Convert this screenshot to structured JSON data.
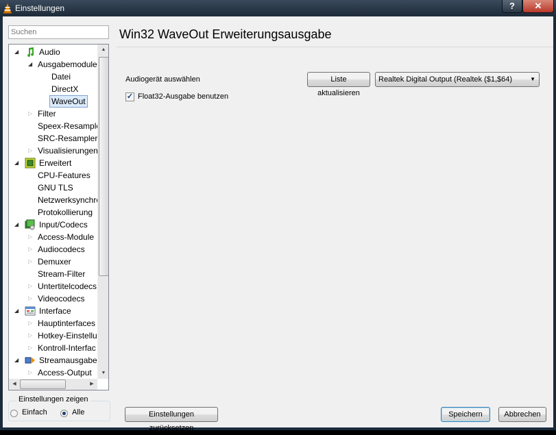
{
  "window": {
    "title": "Einstellungen",
    "help_label": "?",
    "close_label": "✕"
  },
  "search": {
    "placeholder": "Suchen"
  },
  "tree": {
    "items": [
      {
        "label": "Audio",
        "level": 0,
        "expander": "open",
        "icon": "music-note-icon"
      },
      {
        "label": "Ausgabemodule",
        "level": 1,
        "expander": "open"
      },
      {
        "label": "Datei",
        "level": 2,
        "expander": "none"
      },
      {
        "label": "DirectX",
        "level": 2,
        "expander": "none"
      },
      {
        "label": "WaveOut",
        "level": 2,
        "expander": "none",
        "selected": true
      },
      {
        "label": "Filter",
        "level": 1,
        "expander": "closed"
      },
      {
        "label": "Speex-Resampler",
        "level": 1,
        "expander": "none"
      },
      {
        "label": "SRC-Resampler",
        "level": 1,
        "expander": "none"
      },
      {
        "label": "Visualisierungen",
        "level": 1,
        "expander": "closed"
      },
      {
        "label": "Erweitert",
        "level": 0,
        "expander": "open",
        "icon": "chip-icon"
      },
      {
        "label": "CPU-Features",
        "level": 1,
        "expander": "none"
      },
      {
        "label": "GNU TLS",
        "level": 1,
        "expander": "none"
      },
      {
        "label": "Netzwerksynchro",
        "level": 1,
        "expander": "none"
      },
      {
        "label": "Protokollierung",
        "level": 1,
        "expander": "none"
      },
      {
        "label": "Input/Codecs",
        "level": 0,
        "expander": "open",
        "icon": "codec-icon"
      },
      {
        "label": "Access-Module",
        "level": 1,
        "expander": "closed"
      },
      {
        "label": "Audiocodecs",
        "level": 1,
        "expander": "closed"
      },
      {
        "label": "Demuxer",
        "level": 1,
        "expander": "closed"
      },
      {
        "label": "Stream-Filter",
        "level": 1,
        "expander": "none"
      },
      {
        "label": "Untertitelcodecs",
        "level": 1,
        "expander": "closed"
      },
      {
        "label": "Videocodecs",
        "level": 1,
        "expander": "closed"
      },
      {
        "label": "Interface",
        "level": 0,
        "expander": "open",
        "icon": "interface-icon"
      },
      {
        "label": "Hauptinterfaces",
        "level": 1,
        "expander": "closed"
      },
      {
        "label": "Hotkey-Einstellu",
        "level": 1,
        "expander": "closed"
      },
      {
        "label": "Kontroll-Interfac",
        "level": 1,
        "expander": "closed"
      },
      {
        "label": "Streamausgabe",
        "level": 0,
        "expander": "open",
        "icon": "stream-output-icon"
      },
      {
        "label": "Access-Output",
        "level": 1,
        "expander": "closed"
      }
    ]
  },
  "show_settings": {
    "title": "Einstellungen zeigen",
    "simple_label": "Einfach",
    "all_label": "Alle",
    "selected": "Alle"
  },
  "panel": {
    "title": "Win32 WaveOut Erweiterungsausgabe",
    "device_label": "Audiogerät auswählen",
    "refresh_button": "Liste aktualisieren",
    "device_value": "Realtek Digital Output (Realtek ($1,$64)",
    "float32_label": "Float32-Ausgabe benutzen",
    "float32_checked": true
  },
  "buttons": {
    "reset": "Einstellungen zurücksetzen",
    "save": "Speichern",
    "cancel": "Abbrechen"
  }
}
